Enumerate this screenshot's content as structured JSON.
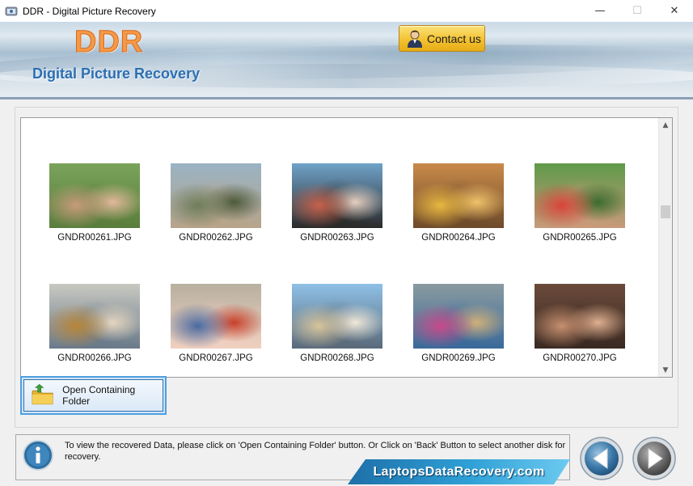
{
  "window": {
    "title": "DDR - Digital Picture Recovery",
    "minimize": "—",
    "maximize": "☐",
    "close": "✕"
  },
  "header": {
    "logo": "DDR",
    "subtitle": "Digital Picture Recovery",
    "contact_label": "Contact us"
  },
  "gallery": {
    "items": [
      {
        "name": "GNDR00261.JPG",
        "colors": [
          "#7aa35a",
          "#c89a7a",
          "#5a7d3c",
          "#e2b89a"
        ]
      },
      {
        "name": "GNDR00262.JPG",
        "colors": [
          "#9ab3c4",
          "#6f7c5a",
          "#b7a48a",
          "#4d5a3a"
        ]
      },
      {
        "name": "GNDR00263.JPG",
        "colors": [
          "#6fa2c8",
          "#c8614a",
          "#2a2a2a",
          "#e6cfc0"
        ]
      },
      {
        "name": "GNDR00264.JPG",
        "colors": [
          "#c98a4a",
          "#e8b840",
          "#6d4a2a",
          "#f0c36a"
        ]
      },
      {
        "name": "GNDR00265.JPG",
        "colors": [
          "#5f9a4a",
          "#d9453a",
          "#c89a7a",
          "#3b6b2f"
        ]
      },
      {
        "name": "GNDR00266.JPG",
        "colors": [
          "#c8c8c0",
          "#b8863a",
          "#6a7a8a",
          "#e6d6c0"
        ]
      },
      {
        "name": "GNDR00267.JPG",
        "colors": [
          "#b8b0a0",
          "#4a6aa0",
          "#f0d0c0",
          "#c8402a"
        ]
      },
      {
        "name": "GNDR00268.JPG",
        "colors": [
          "#8ec0e6",
          "#d8c49a",
          "#5a6a7a",
          "#f0e8d8"
        ]
      },
      {
        "name": "GNDR00269.JPG",
        "colors": [
          "#8a9aa0",
          "#c84a8a",
          "#3a6a9a",
          "#d0b07a"
        ]
      },
      {
        "name": "GNDR00270.JPG",
        "colors": [
          "#6a4a3a",
          "#c89070",
          "#3a2a22",
          "#e0b090"
        ]
      }
    ]
  },
  "actions": {
    "open_folder_label": "Open Containing Folder"
  },
  "status": {
    "info_text": "To view the recovered Data, please click on 'Open Containing Folder' button. Or Click on 'Back' Button to select another disk for recovery.",
    "site": "LaptopsDataRecovery.com"
  },
  "colors": {
    "accent": "#2b6fb3",
    "logo": "#f39a48",
    "contact_button": "#f3c232",
    "selection_border": "#4f9fe0"
  },
  "icons": {
    "app": "app-icon",
    "contact": "person-icon",
    "folder": "folder-icon",
    "info": "info-icon",
    "back": "back-arrow-icon",
    "next": "next-arrow-icon"
  }
}
